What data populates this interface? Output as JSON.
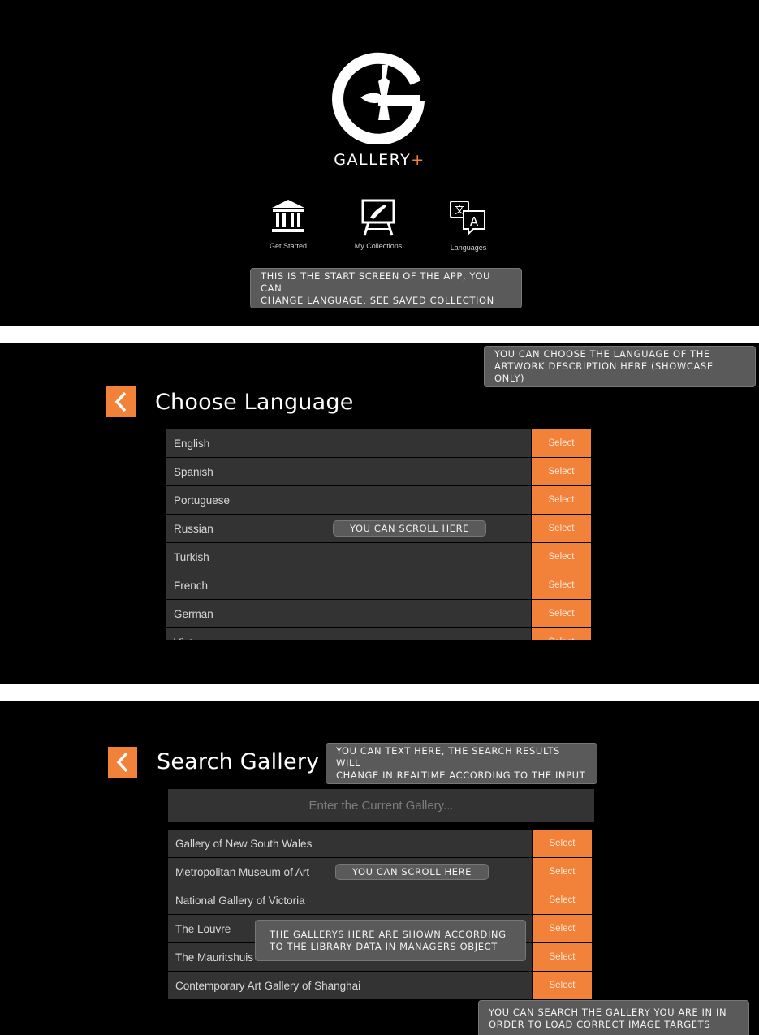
{
  "start_screen": {
    "brand_name": "GALLERY",
    "brand_suffix": "+",
    "accent_color": "#f2813a",
    "menu": [
      {
        "label": "Get Started",
        "icon": "museum-icon"
      },
      {
        "label": "My Collections",
        "icon": "easel-icon"
      },
      {
        "label": "Languages",
        "icon": "translate-icon"
      }
    ],
    "note": "THIS IS THE START SCREEN OF THE APP, YOU CAN\nCHANGE LANGUAGE, SEE SAVED COLLECTION"
  },
  "language_screen": {
    "title": "Choose Language",
    "note_top": "YOU CAN CHOOSE THE LANGUAGE OF THE\nARTWORK DESCRIPTION HERE (SHOWCASE ONLY)",
    "note_scroll": "YOU CAN SCROLL HERE",
    "select_label": "Select",
    "languages": [
      "English",
      "Spanish",
      "Portuguese",
      "Russian",
      "Turkish",
      "French",
      "German",
      "Vietnamese"
    ]
  },
  "gallery_screen": {
    "title": "Search Gallery",
    "search_placeholder": "Enter the Current Gallery...",
    "note_search": "YOU CAN TEXT HERE, THE SEARCH RESULTS WILL\nCHANGE IN REALTIME ACCORDING TO THE INPUT",
    "note_scroll": "YOU CAN SCROLL HERE",
    "note_library": "THE GALLERYS HERE ARE SHOWN ACCORDING\nTO THE LIBRARY DATA IN MANAGERS OBJECT",
    "note_bottom": "YOU CAN SEARCH THE GALLERY YOU ARE IN IN\nORDER TO LOAD CORRECT IMAGE TARGETS",
    "select_label": "Select",
    "galleries": [
      "Gallery of New South Wales",
      "Metropolitan Museum of Art",
      "National Gallery of Victoria",
      "The Louvre",
      "The Mauritshuis",
      "Contemporary Art Gallery of Shanghai"
    ]
  }
}
